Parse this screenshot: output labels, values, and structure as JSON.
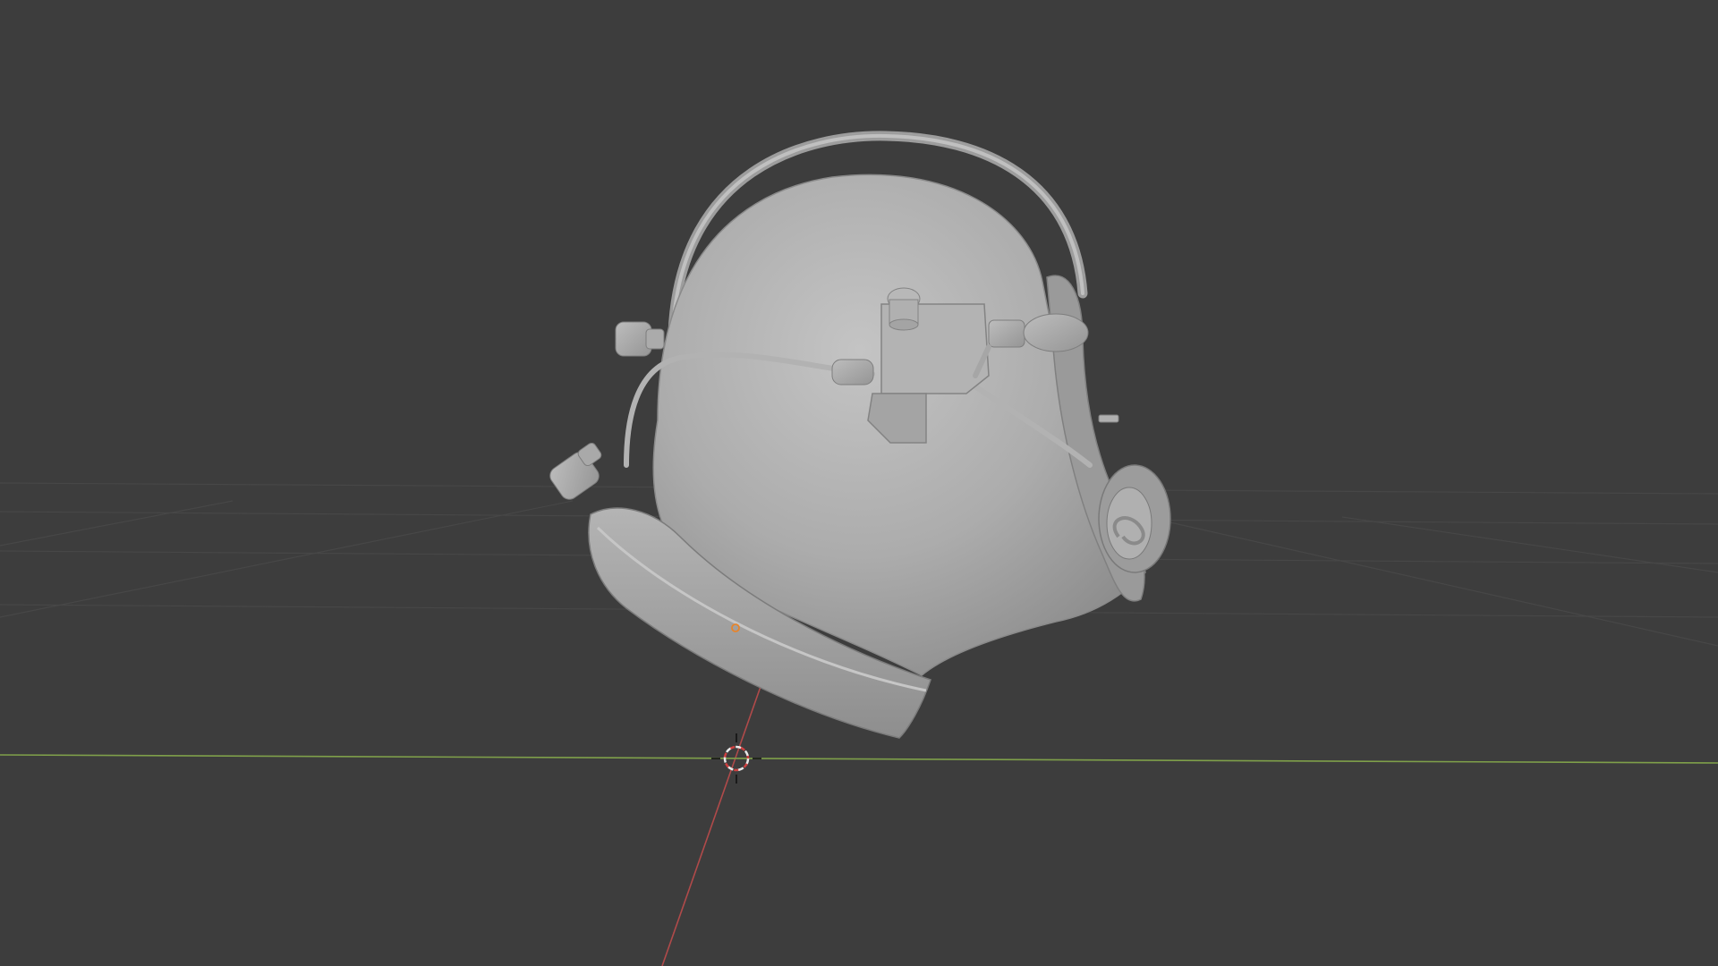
{
  "viewport": {
    "background": "#3d3d3d",
    "grid_color": "#474747",
    "x_axis_color": "#7fa04a",
    "y_axis_color": "#b04a4a",
    "object_color": "#a8a8a8",
    "origin_color": "#e8842a"
  },
  "object": {
    "name": "helmet",
    "selected": false
  },
  "icons": {
    "cursor": "3d-cursor-icon",
    "origin": "object-origin-icon"
  }
}
